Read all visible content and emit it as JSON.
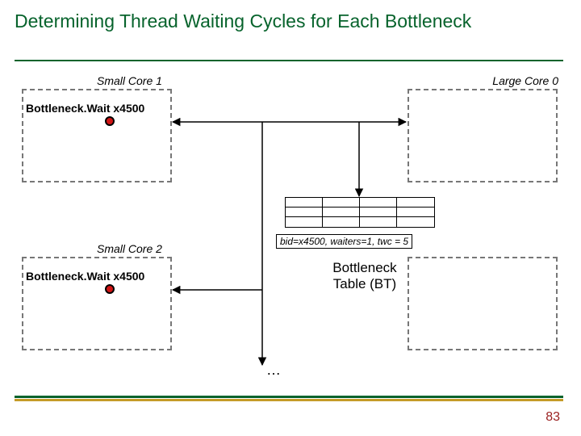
{
  "title": "Determining Thread Waiting Cycles for Each Bottleneck",
  "cores": {
    "small1_label": "Small Core 1",
    "small2_label": "Small Core 2",
    "large0_label": "Large Core 0"
  },
  "wait_calls": {
    "call1": "Bottleneck.Wait x4500",
    "call2": "Bottleneck.Wait x4500"
  },
  "bt": {
    "entry_text": "bid=x4500, waiters=1, twc = 5",
    "caption_line1": "Bottleneck",
    "caption_line2": "Table (BT)"
  },
  "ellipsis": "…",
  "page_number": "83",
  "colors": {
    "title": "#07632c",
    "accent_gold": "#c59b27",
    "dot": "#d11515",
    "page_num": "#9a1f1f"
  }
}
